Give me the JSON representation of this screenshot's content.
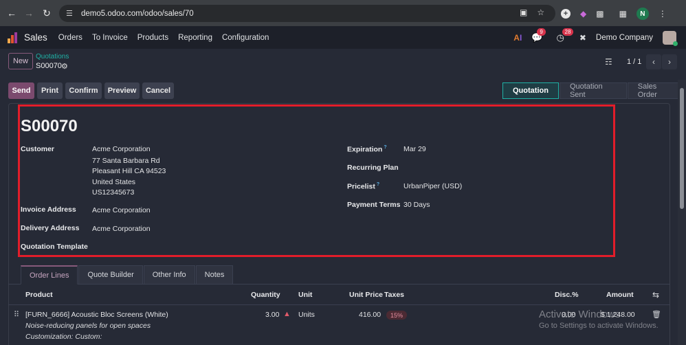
{
  "browser": {
    "url": "demo5.odoo.com/odoo/sales/70",
    "profile_initial": "N"
  },
  "topnav": {
    "app_name": "Sales",
    "menu": [
      "Orders",
      "To Invoice",
      "Products",
      "Reporting",
      "Configuration"
    ],
    "chat_count": "9",
    "activity_count": "28",
    "company": "Demo Company"
  },
  "control": {
    "new_label": "New",
    "breadcrumb_parent": "Quotations",
    "breadcrumb_current": "S00070",
    "pager": "1 / 1"
  },
  "actions": {
    "send": "Send",
    "print": "Print",
    "confirm": "Confirm",
    "preview": "Preview",
    "cancel": "Cancel"
  },
  "status": [
    "Quotation",
    "Quotation Sent",
    "Sales Order"
  ],
  "form": {
    "title": "S00070",
    "customer_label": "Customer",
    "customer_lines": [
      "Acme Corporation",
      "77 Santa Barbara Rd",
      "Pleasant Hill CA 94523",
      "United States",
      "US12345673"
    ],
    "invoice_label": "Invoice Address",
    "invoice_value": "Acme Corporation",
    "delivery_label": "Delivery Address",
    "delivery_value": "Acme Corporation",
    "template_label": "Quotation Template",
    "expiration_label": "Expiration",
    "expiration_value": "Mar 29",
    "recurring_label": "Recurring Plan",
    "pricelist_label": "Pricelist",
    "pricelist_value": "UrbanPiper (USD)",
    "payment_label": "Payment Terms",
    "payment_value": "30 Days",
    "help_mark": "?"
  },
  "tabs": [
    "Order Lines",
    "Quote Builder",
    "Other Info",
    "Notes"
  ],
  "table": {
    "headers": {
      "product": "Product",
      "quantity": "Quantity",
      "unit": "Unit",
      "unit_price": "Unit Price",
      "taxes": "Taxes",
      "disc": "Disc.%",
      "amount": "Amount"
    },
    "row": {
      "product": "[FURN_6666] Acoustic Bloc Screens (White)",
      "description": "Noise-reducing panels for open spaces",
      "customization": "Customization: Custom:",
      "quantity": "3.00",
      "unit": "Units",
      "unit_price": "416.00",
      "tax": "15%",
      "disc": "0.00",
      "amount": "$ 1,248.00"
    }
  },
  "watermark": {
    "line1": "Activate Windows",
    "line2": "Go to Settings to activate Windows."
  }
}
